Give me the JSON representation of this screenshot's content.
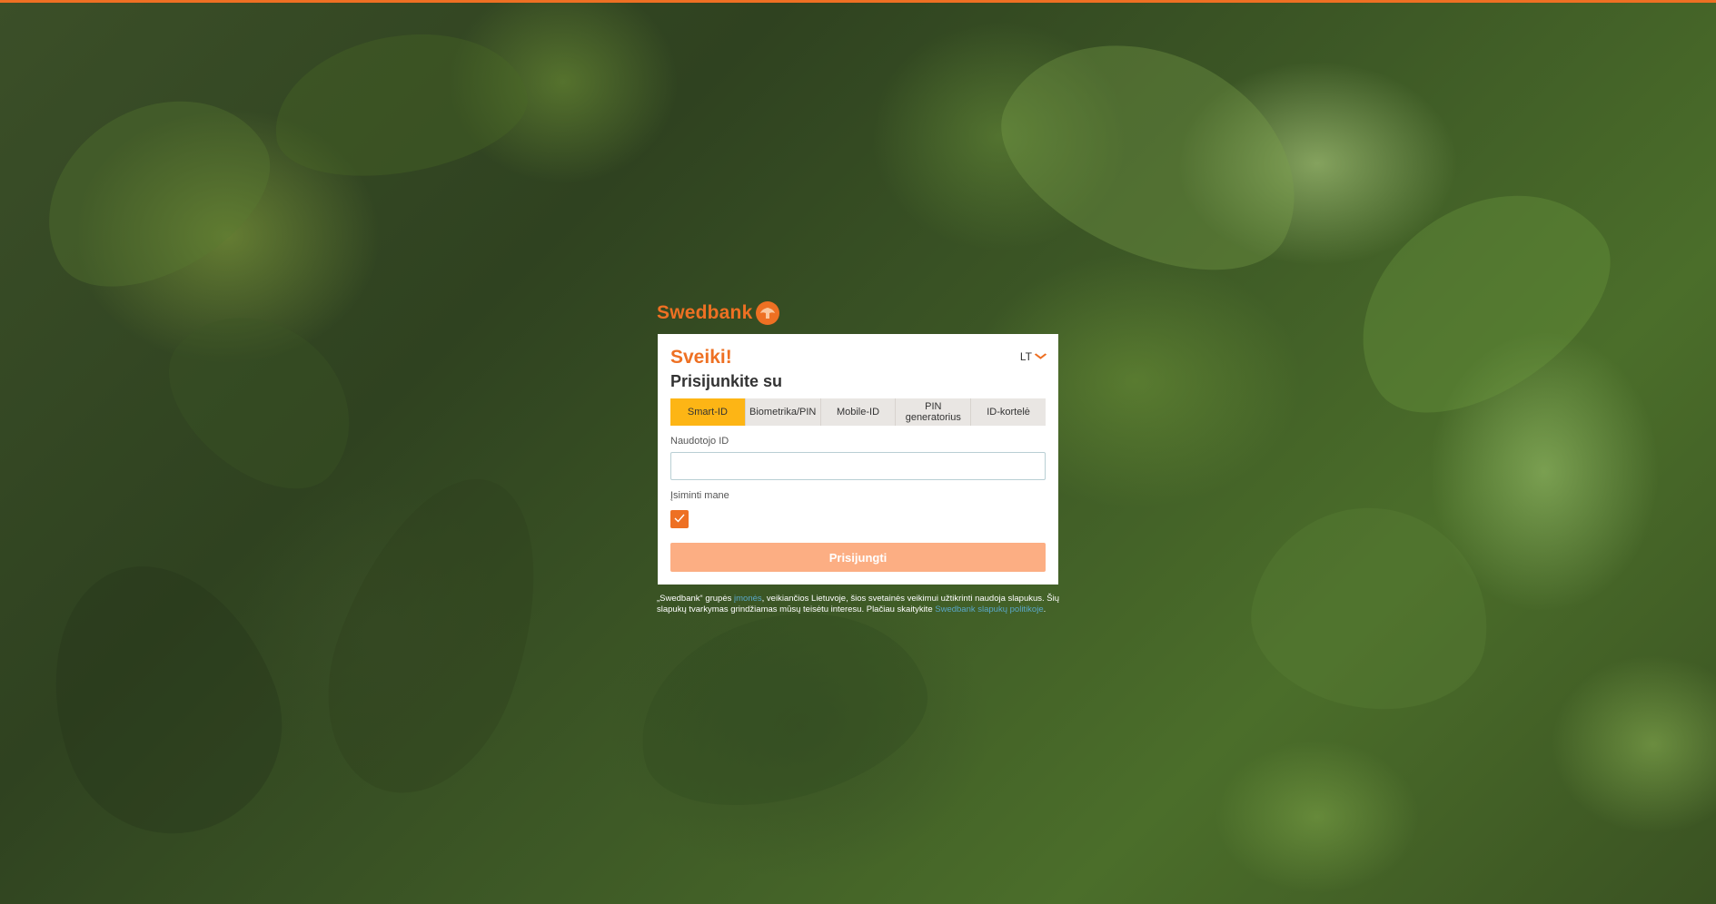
{
  "colors": {
    "brand": "#ee7023",
    "tab_active": "#fdb515",
    "button_disabled": "#fcae83",
    "link": "#5aa7c8"
  },
  "header": {
    "logo_text": "Swedbank",
    "logo_icon": "swedbank-oak-icon"
  },
  "login": {
    "greeting": "Sveiki!",
    "language": "LT",
    "subtitle": "Prisijunkite su",
    "tabs": [
      {
        "label": "Smart-ID",
        "active": true
      },
      {
        "label": "Biometrika/PIN",
        "active": false
      },
      {
        "label": "Mobile-ID",
        "active": false
      },
      {
        "label": "PIN generatorius",
        "active": false
      },
      {
        "label": "ID-kortelė",
        "active": false
      }
    ],
    "user_id_label": "Naudotojo ID",
    "user_id_value": "",
    "remember_label": "Įsiminti mane",
    "remember_checked": true,
    "submit_label": "Prisijungti"
  },
  "cookie_notice": {
    "text_1": "„Swedbank“ grupės ",
    "link_1": "įmonės",
    "text_2": ", veikiančios Lietuvoje, šios svetainės veikimui užtikrinti naudoja slapukus. Šių slapukų tvarkymas grindžiamas mūsų teisėtu interesu. Plačiau skaitykite ",
    "link_2": "Swedbank slapukų politikoje",
    "text_3": "."
  }
}
